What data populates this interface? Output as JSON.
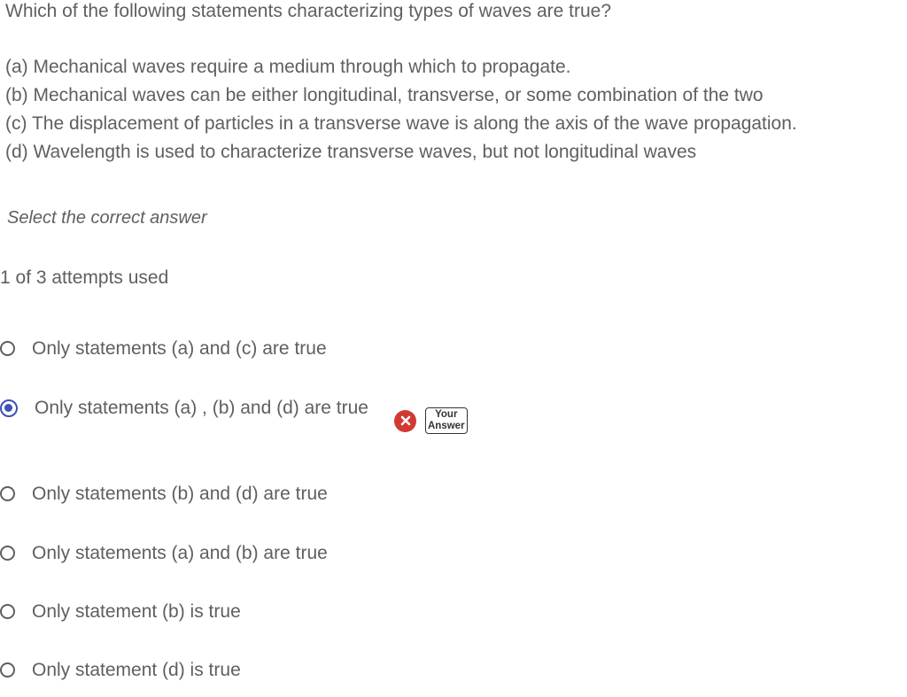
{
  "question": {
    "text": "Which of the following statements characterizing types of waves are true?",
    "statements": [
      "(a) Mechanical waves require a medium through which to propagate.",
      "(b) Mechanical waves can be either longitudinal, transverse, or some combination of the two",
      "(c) The displacement of particles in a transverse wave is along the axis of the wave propagation.",
      "(d) Wavelength is used to characterize transverse waves, but not longitudinal waves"
    ]
  },
  "instruction": "Select the correct answer",
  "attempts": "1 of 3 attempts used",
  "options": [
    {
      "label": "Only statements (a) and (c) are true",
      "selected": false
    },
    {
      "label": "Only statements (a) , (b) and (d) are true",
      "selected": true
    },
    {
      "label": "Only statements (b) and (d) are true",
      "selected": false
    },
    {
      "label": "Only statements (a) and (b) are true",
      "selected": false
    },
    {
      "label": "Only statement (b) is true",
      "selected": false
    },
    {
      "label": "Only statement (d) is true",
      "selected": false
    }
  ],
  "feedback": {
    "status": "incorrect",
    "icon": "x-circle-icon",
    "badge_label": "Your Answer",
    "badge_line1": "Your",
    "badge_line2": "Answer",
    "status_color": "#d13a32"
  },
  "colors": {
    "accent": "#3f51b5",
    "text": "#5f5f5f"
  }
}
